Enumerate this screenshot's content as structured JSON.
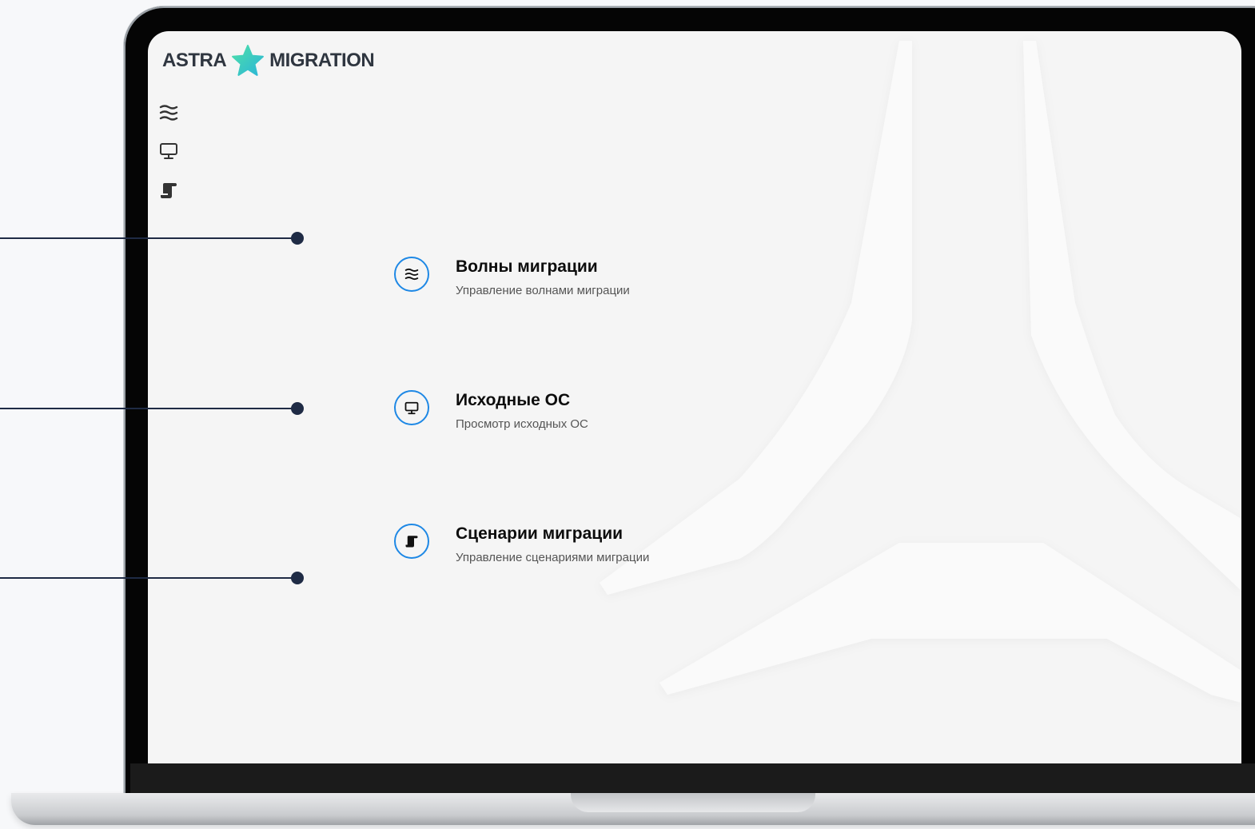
{
  "logo": {
    "left_text": "ASTRA",
    "right_text": "MIGRATION",
    "star_color": "#3fd1b0"
  },
  "sidebar": {
    "items": [
      {
        "icon": "waves-icon"
      },
      {
        "icon": "monitor-icon"
      },
      {
        "icon": "scroll-icon"
      }
    ]
  },
  "menu": {
    "items": [
      {
        "title": "Волны миграции",
        "subtitle": "Управление волнами миграции",
        "icon": "waves-icon"
      },
      {
        "title": "Исходные ОС",
        "subtitle": "Просмотр исходных ОС",
        "icon": "monitor-icon"
      },
      {
        "title": "Сценарии миграции",
        "subtitle": "Управление сценариями миграции",
        "icon": "scroll-icon"
      }
    ]
  },
  "colors": {
    "accent": "#1e88e5",
    "callout": "#1f2b45",
    "screen_bg": "#f5f5f5"
  }
}
